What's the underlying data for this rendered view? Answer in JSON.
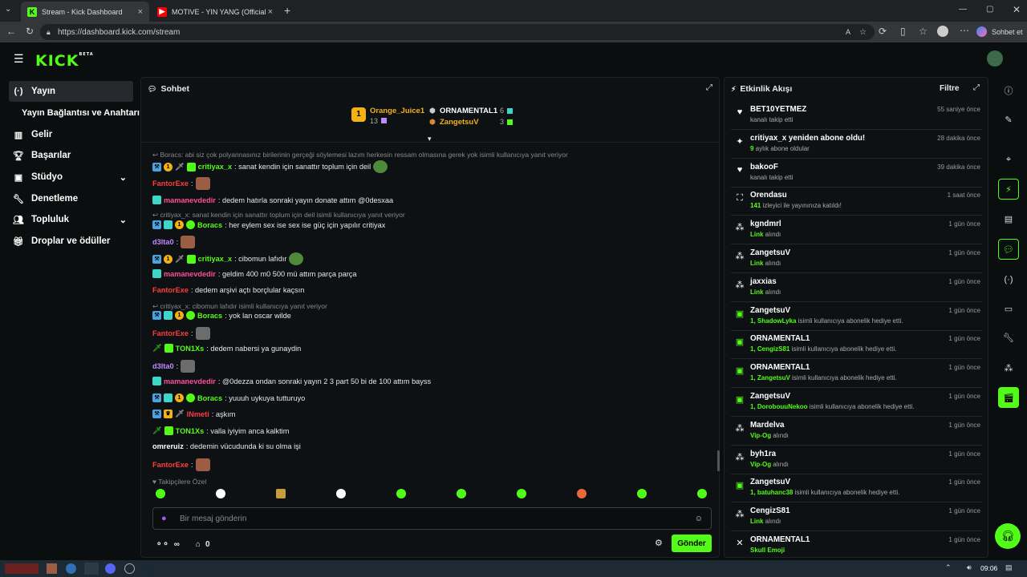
{
  "browser": {
    "tabs": [
      {
        "title": "Stream - Kick Dashboard",
        "active": true
      },
      {
        "title": "MOTIVE - YIN YANG (Official M",
        "active": false
      }
    ],
    "url": "https://dashboard.kick.com/stream",
    "copilot_label": "Sohbet et"
  },
  "sidebar": {
    "items": [
      {
        "label": "Yayın",
        "icon": "broadcast-icon",
        "active": true
      },
      {
        "label": "Yayın Bağlantısı ve Anahtarı",
        "icon": "",
        "active": false
      },
      {
        "label": "Gelir",
        "icon": "chart-icon",
        "active": false
      },
      {
        "label": "Başarılar",
        "icon": "trophy-icon",
        "active": false
      },
      {
        "label": "Stüdyo",
        "icon": "studio-icon",
        "active": false,
        "expandable": true
      },
      {
        "label": "Denetleme",
        "icon": "wrench-icon",
        "active": false
      },
      {
        "label": "Topluluk",
        "icon": "community-icon",
        "active": false,
        "expandable": true
      },
      {
        "label": "Droplar ve ödüller",
        "icon": "gift-icon",
        "active": false
      }
    ]
  },
  "chat": {
    "title": "Sohbet",
    "leaderboard": {
      "first": {
        "name": "Orange_Juice1",
        "count": "13",
        "rank": "1"
      },
      "second": {
        "name": "ORNAMENTAL1",
        "count": "6"
      },
      "third": {
        "name": "ZangetsuV",
        "count": "3"
      }
    },
    "messages": [
      {
        "type": "reply",
        "text": "Boracs: abi siz çok polyannasınız birilerinin gerçeği söylemesi lazım herkesin ressam olmasına gerek yok isimli kullanıcıya yanıt veriyor"
      },
      {
        "user": "critiyax_x",
        "color": "green",
        "text": ": sanat kendin için sanattır toplum için deil"
      },
      {
        "user": "FantorExe",
        "color": "red",
        "text": ":"
      },
      {
        "user": "mamanevdedir",
        "color": "pink",
        "text": ": dedem hatırla sonraki yayın donate attım @0desxaa"
      },
      {
        "type": "reply",
        "text": "critiyax_x: sanat kendin için sanattır toplum için deil  isimli kullanıcıya yanıt veriyor"
      },
      {
        "user": "Boracs",
        "color": "green",
        "text": ": her eylem sex ise sex ise güç için yapılır critiyax"
      },
      {
        "user": "d3lta0",
        "color": "purple",
        "text": ":"
      },
      {
        "user": "critiyax_x",
        "color": "green",
        "text": ": cibomun lafıdır"
      },
      {
        "user": "mamanevdedir",
        "color": "pink",
        "text": ": geldim 400 m0 500 mü attım parça parça"
      },
      {
        "user": "FantorExe",
        "color": "red",
        "text": ": dedem arşivi açtı borçlular kaçsın"
      },
      {
        "type": "reply",
        "text": "critiyax_x: cibomun lafıdır  isimli kullanıcıya yanıt veriyor"
      },
      {
        "user": "Boracs",
        "color": "green",
        "text": ": yok lan oscar wilde"
      },
      {
        "user": "FantorExe",
        "color": "red",
        "text": ":"
      },
      {
        "user": "TON1Xs",
        "color": "green",
        "text": ": dedem nabersi ya gunaydin"
      },
      {
        "user": "d3lta0",
        "color": "purple",
        "text": ":"
      },
      {
        "user": "mamanevdedir",
        "color": "pink",
        "text": ": @0dezza ondan sonraki yayın 2 3 part 50 bi de 100 attım bayss"
      },
      {
        "user": "Boracs",
        "color": "green",
        "text": ": yuuuh uykuya tutturuyo"
      },
      {
        "user": "INmeti",
        "color": "red",
        "text": ": aşkım"
      },
      {
        "user": "TON1Xs",
        "color": "green",
        "text": ": valla iyiyim anca kalktim"
      },
      {
        "user": "omreruiz",
        "color": "white",
        "text": ": dedemin vücudunda ki su olma işi"
      },
      {
        "user": "FantorExe",
        "color": "red",
        "text": ":"
      }
    ],
    "followers_only": "Takipçilere Özel",
    "input_placeholder": "Bir mesaj gönderin",
    "send_label": "Gönder",
    "viewer_stat": "∞",
    "store_stat": "0"
  },
  "activity": {
    "title": "Etkinlik Akışı",
    "filter_label": "Filtre",
    "items": [
      {
        "icon": "heart-icon",
        "name": "BET10YETMEZ",
        "sub": "kanalı takip etti",
        "time": "55 saniye önce"
      },
      {
        "icon": "sparkle-icon",
        "name": "critiyax_x yeniden abone oldu!",
        "sub_hl": "9",
        "sub": " aylık abone oldular",
        "time": "28 dakika önce"
      },
      {
        "icon": "heart-icon",
        "name": "bakooF",
        "sub": "kanalı takip etti",
        "time": "39 dakika önce"
      },
      {
        "icon": "raid-icon",
        "name": "Orendasu",
        "sub_hl": "141",
        "sub": " izleyici ile yayınınıza katıldı!",
        "time": "1 saat önce"
      },
      {
        "icon": "reward-icon",
        "name": "kgndmrl",
        "sub_hl": "Link",
        "sub": " alındı",
        "time": "1 gün önce"
      },
      {
        "icon": "reward-icon",
        "name": "ZangetsuV",
        "sub_hl": "Link",
        "sub": " alındı",
        "time": "1 gün önce"
      },
      {
        "icon": "reward-icon",
        "name": "jaxxias",
        "sub_hl": "Link",
        "sub": " alındı",
        "time": "1 gün önce"
      },
      {
        "icon": "gift-icon",
        "name": "ZangetsuV",
        "sub_hl": "1, ShadowLyka",
        "sub": " isimli kullanıcıya abonelik hediye etti.",
        "time": "1 gün önce"
      },
      {
        "icon": "gift-icon",
        "name": "ORNAMENTAL1",
        "sub_hl": "1, CengizS81",
        "sub": " isimli kullanıcıya abonelik hediye etti.",
        "time": "1 gün önce"
      },
      {
        "icon": "gift-icon",
        "name": "ORNAMENTAL1",
        "sub_hl": "1, ZangetsuV",
        "sub": " isimli kullanıcıya abonelik hediye etti.",
        "time": "1 gün önce"
      },
      {
        "icon": "gift-icon",
        "name": "ZangetsuV",
        "sub_hl": "1, DorobouuNekoo",
        "sub": " isimli kullanıcıya abonelik hediye etti.",
        "time": "1 gün önce"
      },
      {
        "icon": "reward-icon",
        "name": "Mardelva",
        "sub_hl": "Vip-Og",
        "sub": " alındı",
        "time": "1 gün önce"
      },
      {
        "icon": "reward-icon",
        "name": "byh1ra",
        "sub_hl": "Vip-Og",
        "sub": " alındı",
        "time": "1 gün önce"
      },
      {
        "icon": "gift-icon",
        "name": "ZangetsuV",
        "sub_hl": "1, batuhanc38",
        "sub": " isimli kullanıcıya abonelik hediye etti.",
        "time": "1 gün önce"
      },
      {
        "icon": "reward-icon",
        "name": "CengizS81",
        "sub_hl": "Link",
        "sub": " alındı",
        "time": "1 gün önce"
      },
      {
        "icon": "kick-icon",
        "name": "ORNAMENTAL1",
        "sub_hl": "Skull Emoji",
        "sub": "",
        "time": "1 gün önce"
      }
    ]
  },
  "taskbar": {
    "clock": "09:06"
  },
  "colors": {
    "accent": "#53fc18",
    "background": "#0b0e0f",
    "panel": "#0e1113"
  }
}
